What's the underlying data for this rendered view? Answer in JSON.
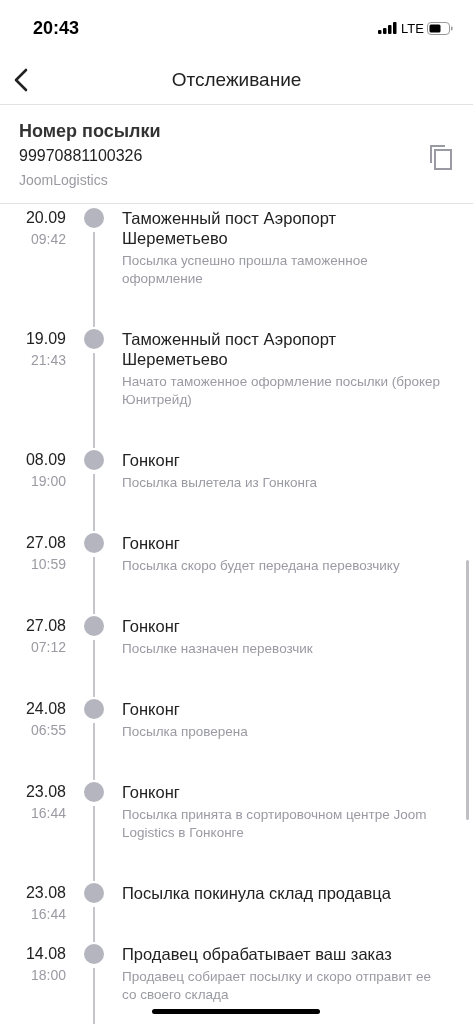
{
  "status_bar": {
    "time": "20:43",
    "network": "LTE"
  },
  "nav": {
    "title": "Отслеживание"
  },
  "parcel": {
    "label": "Номер посылки",
    "number": "99970881100326",
    "carrier": "JoomLogistics"
  },
  "events": [
    {
      "date": "20.09",
      "time": "09:42",
      "title": "Таможенный пост Аэропорт Шереметьево",
      "description": "Посылка успешно прошла таможенное оформление"
    },
    {
      "date": "19.09",
      "time": "21:43",
      "title": "Таможенный пост Аэропорт Шереметьево",
      "description": "Начато таможенное оформление посылки (брокер Юнитрейд)"
    },
    {
      "date": "08.09",
      "time": "19:00",
      "title": "Гонконг",
      "description": "Посылка вылетела из Гонконга"
    },
    {
      "date": "27.08",
      "time": "10:59",
      "title": "Гонконг",
      "description": "Посылка скоро будет передана перевозчику"
    },
    {
      "date": "27.08",
      "time": "07:12",
      "title": "Гонконг",
      "description": "Посылке назначен перевозчик"
    },
    {
      "date": "24.08",
      "time": "06:55",
      "title": "Гонконг",
      "description": "Посылка проверена"
    },
    {
      "date": "23.08",
      "time": "16:44",
      "title": "Гонконг",
      "description": "Посылка принята в сортировочном центре Joom Logistics в Гонконге"
    },
    {
      "date": "23.08",
      "time": "16:44",
      "title": "Посылка покинула склад продавца"
    },
    {
      "date": "14.08",
      "time": "18:00",
      "title": "Продавец обрабатывает ваш заказ",
      "description": "Продавец собирает посылку и скоро отправит ее со своего склада"
    }
  ]
}
